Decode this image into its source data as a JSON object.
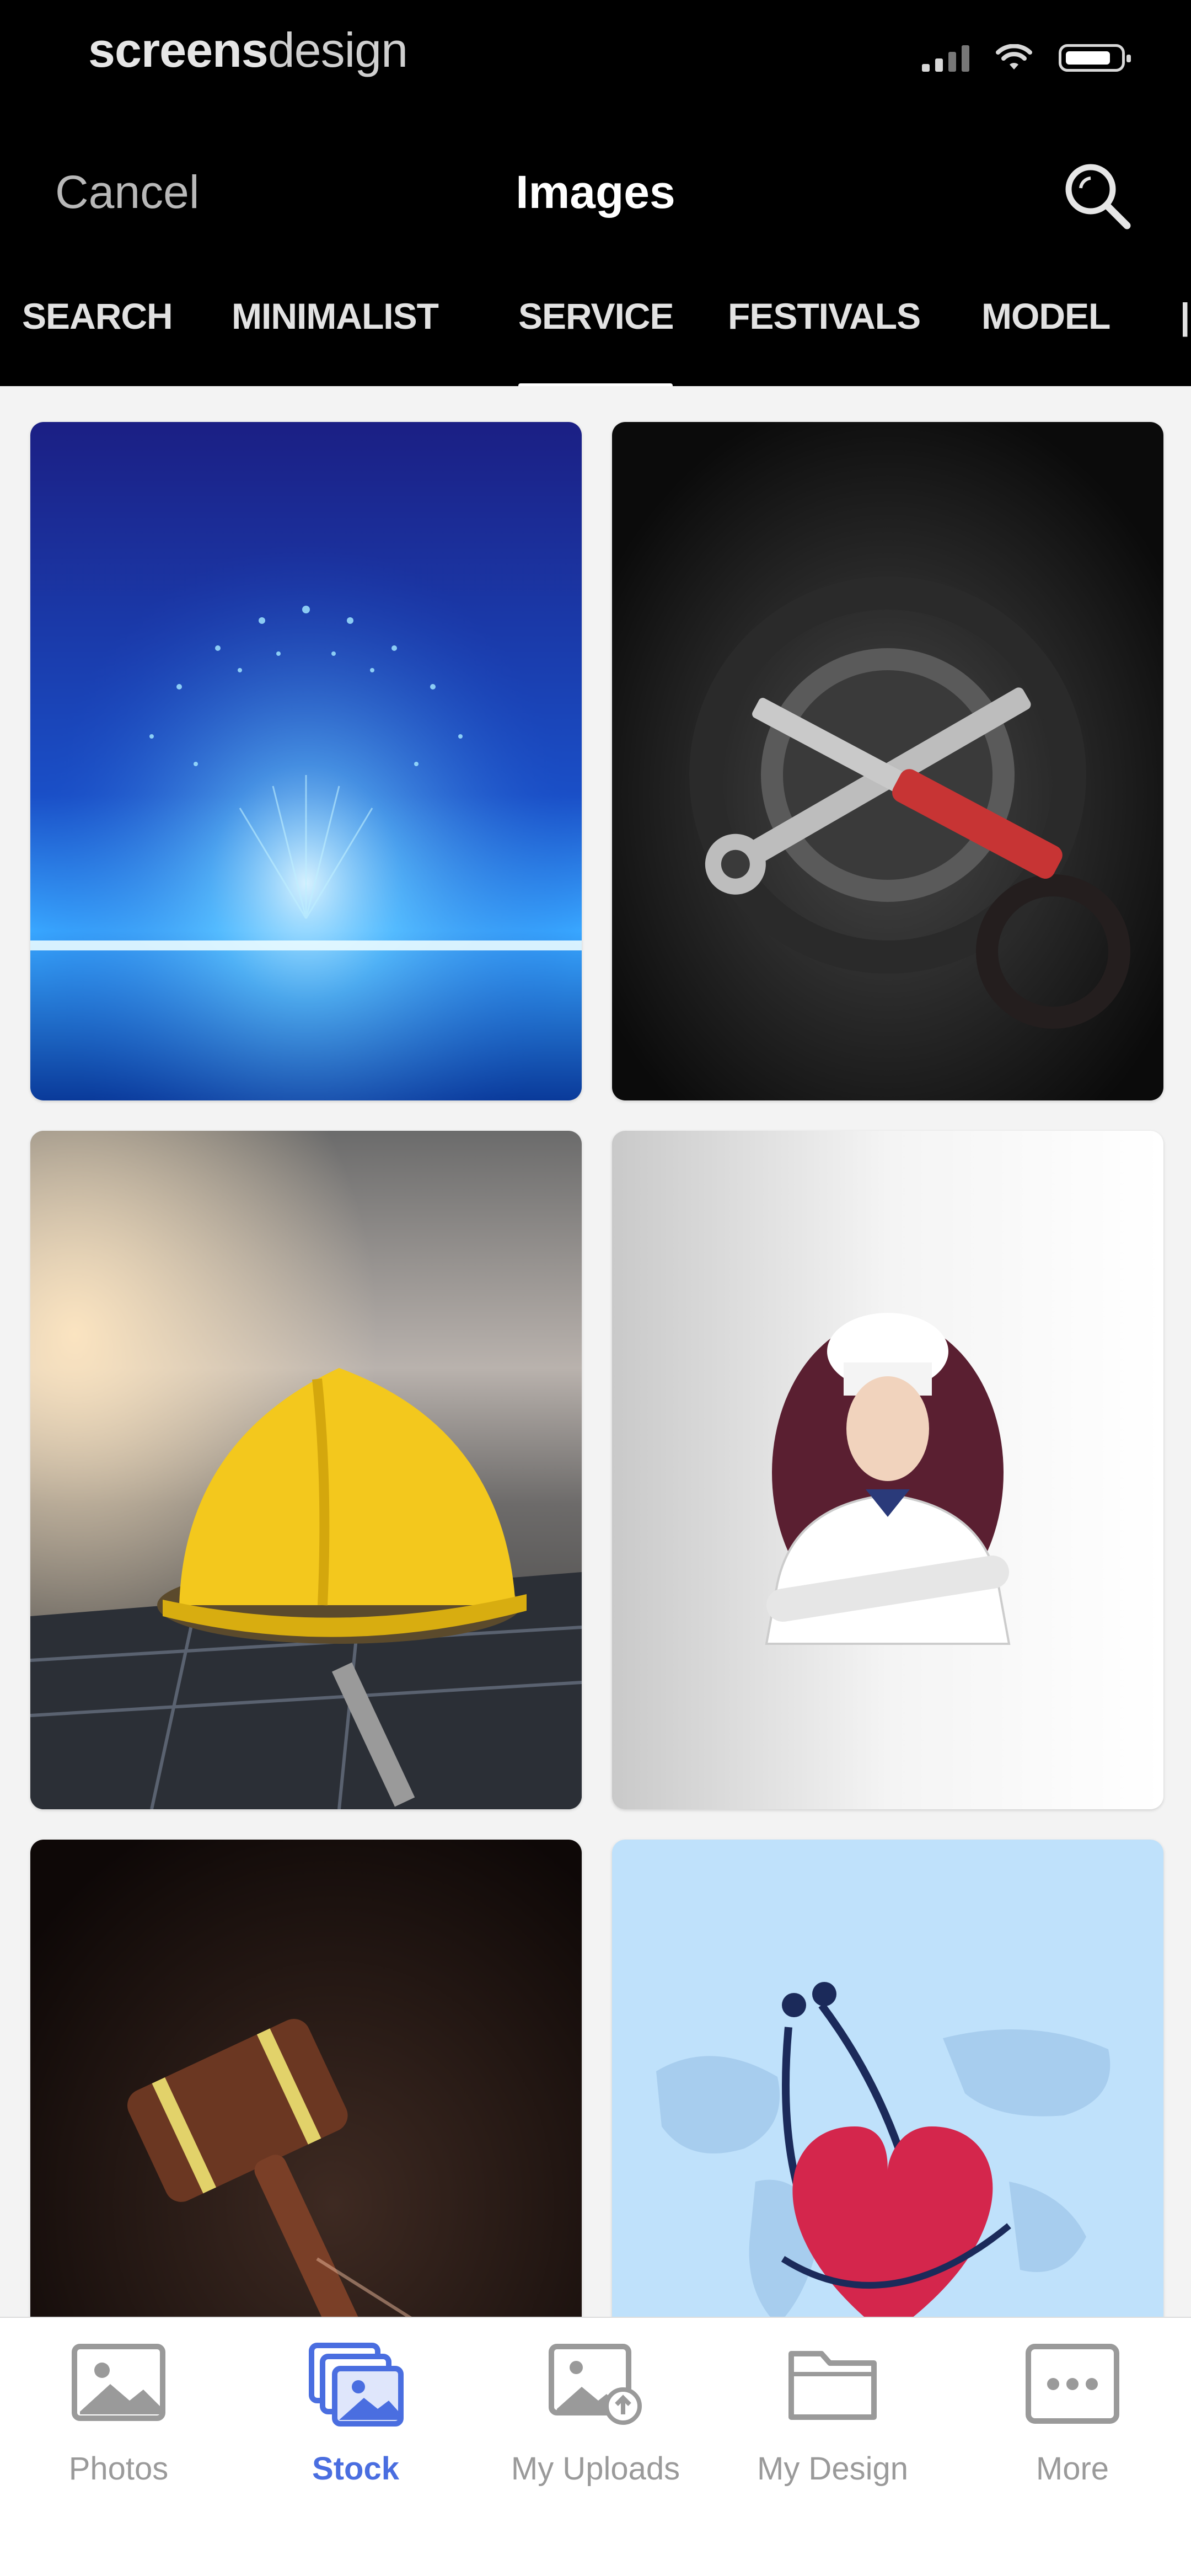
{
  "status_bar": {
    "brand_bold": "screens",
    "brand_light": "design"
  },
  "header": {
    "cancel_label": "Cancel",
    "title": "Images",
    "search_icon": "search-icon"
  },
  "category_tabs": [
    {
      "label": "SEARCH",
      "active": false
    },
    {
      "label": "MINIMALIST",
      "active": false
    },
    {
      "label": "SERVICE",
      "active": true
    },
    {
      "label": "FESTIVALS",
      "active": false
    },
    {
      "label": "MODEL",
      "active": false
    }
  ],
  "images": [
    {
      "subject": "blue digital tree",
      "icon": "image-digital-tree"
    },
    {
      "subject": "wrench and screwdriver over gears",
      "icon": "image-tools-gear"
    },
    {
      "subject": "yellow hard hat on solar panel",
      "icon": "image-hard-hat"
    },
    {
      "subject": "chef illustration",
      "icon": "image-chef"
    },
    {
      "subject": "judge gavel",
      "icon": "image-gavel"
    },
    {
      "subject": "stethoscope heart",
      "icon": "image-stethoscope-heart"
    }
  ],
  "bottom_tabs": [
    {
      "label": "Photos",
      "icon": "photo-icon",
      "active": false
    },
    {
      "label": "Stock",
      "icon": "stock-images-icon",
      "active": true
    },
    {
      "label": "My Uploads",
      "icon": "upload-icon",
      "active": false
    },
    {
      "label": "My Design",
      "icon": "folder-icon",
      "active": false
    },
    {
      "label": "More",
      "icon": "more-icon",
      "active": false
    }
  ],
  "colors": {
    "header_bg": "#000000",
    "accent": "#4a6ee0",
    "inactive": "#9a9a9a"
  }
}
